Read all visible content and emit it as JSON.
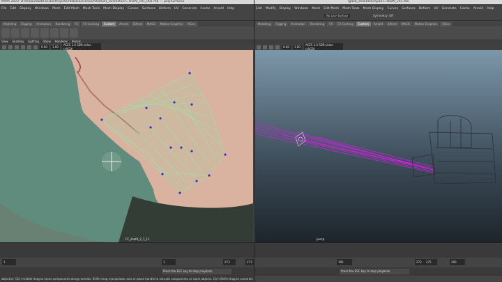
{
  "left": {
    "title": "MAYA 2022: D:/tesla/Adult/Facials/Projects/rbDollie/scenes/hd/shot1_02/shot1/FC-shot9_v01_001.mb --- polySurface1",
    "menu": [
      "File",
      "Edit",
      "Display",
      "Windows",
      "Mesh",
      "Edit Mesh",
      "Mesh Tools",
      "Mesh Display",
      "Curves",
      "Surfaces",
      "Deform",
      "UV",
      "Generate",
      "Cache",
      "Arnold",
      "Help"
    ],
    "surface_combo": "No Live Surface",
    "symmetry": "Symmetry: Off",
    "shelf_tabs": [
      "Modeling",
      "Rigging",
      "Animation",
      "Rendering",
      "FX",
      "FX Caching",
      "Custom",
      "Arnold",
      "Bifrost",
      "MASH",
      "Motion Graphics",
      "XGen"
    ],
    "panel_menu": [
      "View",
      "Shading",
      "Lighting",
      "Show",
      "Renderer",
      "Panels"
    ],
    "toolbar": {
      "val1": "0.00",
      "val2": "1.00",
      "colorspace": "ACES 1.0 SDR-video (sRGB)"
    },
    "camera_label": "FC_shot9_2_1_11",
    "range": {
      "start": "1",
      "inner_start": "1",
      "inner_end": "273",
      "end": "273"
    },
    "cmd_message": "Press the ESC key to stop playback."
  },
  "right": {
    "title": "/gdeb_shot1/Denaya/FC-shot9_v01.mb",
    "menu": [
      "Edit",
      "Modify",
      "Display",
      "Windows",
      "Mesh",
      "Edit Mesh",
      "Mesh Tools",
      "Mesh Display",
      "Curves",
      "Surfaces",
      "Deform",
      "UV",
      "Generate",
      "Cache",
      "Arnold",
      "Help"
    ],
    "surface_combo": "No Live Surface",
    "symmetry": "Symmetry: Off",
    "shelf_tabs": [
      "Modeling",
      "Rigging",
      "Animation",
      "Rendering",
      "FX",
      "FX Caching",
      "Custom",
      "Arnold",
      "Bifrost",
      "MASH",
      "Motion Graphics",
      "XGen"
    ],
    "toolbar": {
      "val1": "0.00",
      "val2": "1.00",
      "colorspace": "ACES 1.0 SDR-video (sRGB)"
    },
    "camera_label": "persp",
    "range": {
      "start": "185",
      "inner_start": "273",
      "inner_end": "275",
      "end": "280"
    },
    "cmd_message": "Press the ESC key to stop playback."
  },
  "helpline": "object(s). Ctrl+middle-drag to move components along normals. Shift+drag manipulator axis or plane handle to extrude components or clone objects. Ctrl+Shift+drag to constrain movement to a connected edge. Use D",
  "colors": {
    "wire": "#8fe8a8",
    "point": "#3a2ad6",
    "motion_path": "#d020e0",
    "green_screen": "#5f8c7c"
  }
}
